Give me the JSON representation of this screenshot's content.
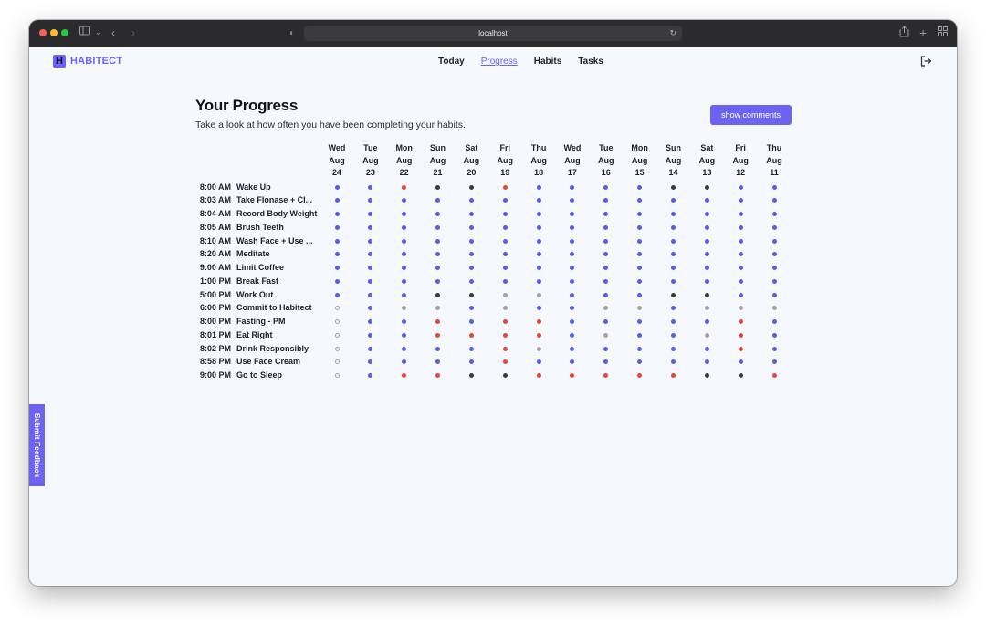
{
  "browser": {
    "url": "localhost"
  },
  "header": {
    "brand": "HABITECT",
    "brand_logo": "H",
    "nav": [
      {
        "label": "Today",
        "active": false
      },
      {
        "label": "Progress",
        "active": true
      },
      {
        "label": "Habits",
        "active": false
      },
      {
        "label": "Tasks",
        "active": false
      }
    ],
    "logout_icon": "logout-icon"
  },
  "main": {
    "title": "Your Progress",
    "subtitle": "Take a look at how often you have been completing your habits.",
    "show_comments_label": "show comments"
  },
  "status_colors": {
    "B": "#5b5be8",
    "R": "#e8443a",
    "K": "#3a3a3e",
    "G": "#a3a3a8",
    "O": "outline-gray"
  },
  "dates": [
    {
      "day": "Wed",
      "month": "Aug",
      "date": "24"
    },
    {
      "day": "Tue",
      "month": "Aug",
      "date": "23"
    },
    {
      "day": "Mon",
      "month": "Aug",
      "date": "22"
    },
    {
      "day": "Sun",
      "month": "Aug",
      "date": "21"
    },
    {
      "day": "Sat",
      "month": "Aug",
      "date": "20"
    },
    {
      "day": "Fri",
      "month": "Aug",
      "date": "19"
    },
    {
      "day": "Thu",
      "month": "Aug",
      "date": "18"
    },
    {
      "day": "Wed",
      "month": "Aug",
      "date": "17"
    },
    {
      "day": "Tue",
      "month": "Aug",
      "date": "16"
    },
    {
      "day": "Mon",
      "month": "Aug",
      "date": "15"
    },
    {
      "day": "Sun",
      "month": "Aug",
      "date": "14"
    },
    {
      "day": "Sat",
      "month": "Aug",
      "date": "13"
    },
    {
      "day": "Fri",
      "month": "Aug",
      "date": "12"
    },
    {
      "day": "Thu",
      "month": "Aug",
      "date": "11"
    }
  ],
  "habits": [
    {
      "time": "8:00 AM",
      "name": "Wake Up",
      "statuses": [
        "B",
        "B",
        "R",
        "K",
        "K",
        "R",
        "B",
        "B",
        "B",
        "B",
        "K",
        "K",
        "B",
        "B"
      ]
    },
    {
      "time": "8:03 AM",
      "name": "Take Flonase + Cl...",
      "statuses": [
        "B",
        "B",
        "B",
        "B",
        "B",
        "B",
        "B",
        "B",
        "B",
        "B",
        "B",
        "B",
        "B",
        "B"
      ]
    },
    {
      "time": "8:04 AM",
      "name": "Record Body Weight",
      "statuses": [
        "B",
        "B",
        "B",
        "B",
        "B",
        "B",
        "B",
        "B",
        "B",
        "B",
        "B",
        "B",
        "B",
        "B"
      ]
    },
    {
      "time": "8:05 AM",
      "name": "Brush Teeth",
      "statuses": [
        "B",
        "B",
        "B",
        "B",
        "B",
        "B",
        "B",
        "B",
        "B",
        "B",
        "B",
        "B",
        "B",
        "B"
      ]
    },
    {
      "time": "8:10 AM",
      "name": "Wash Face + Use ...",
      "statuses": [
        "B",
        "B",
        "B",
        "B",
        "B",
        "B",
        "B",
        "B",
        "B",
        "B",
        "B",
        "B",
        "B",
        "B"
      ]
    },
    {
      "time": "8:20 AM",
      "name": "Meditate",
      "statuses": [
        "B",
        "B",
        "B",
        "B",
        "B",
        "B",
        "B",
        "B",
        "B",
        "B",
        "B",
        "B",
        "B",
        "B"
      ]
    },
    {
      "time": "9:00 AM",
      "name": "Limit Coffee",
      "statuses": [
        "B",
        "B",
        "B",
        "B",
        "B",
        "B",
        "B",
        "B",
        "B",
        "B",
        "B",
        "B",
        "B",
        "B"
      ]
    },
    {
      "time": "1:00 PM",
      "name": "Break Fast",
      "statuses": [
        "B",
        "B",
        "B",
        "B",
        "B",
        "B",
        "B",
        "B",
        "B",
        "B",
        "B",
        "B",
        "B",
        "B"
      ]
    },
    {
      "time": "5:00 PM",
      "name": "Work Out",
      "statuses": [
        "B",
        "B",
        "B",
        "K",
        "K",
        "G",
        "G",
        "B",
        "B",
        "B",
        "K",
        "K",
        "B",
        "B"
      ]
    },
    {
      "time": "6:00 PM",
      "name": "Commit to Habitect",
      "statuses": [
        "O",
        "B",
        "G",
        "G",
        "B",
        "G",
        "B",
        "B",
        "G",
        "G",
        "B",
        "G",
        "G",
        "G"
      ]
    },
    {
      "time": "8:00 PM",
      "name": "Fasting - PM",
      "statuses": [
        "O",
        "B",
        "B",
        "R",
        "B",
        "R",
        "R",
        "B",
        "B",
        "B",
        "B",
        "B",
        "R",
        "B"
      ]
    },
    {
      "time": "8:01 PM",
      "name": "Eat Right",
      "statuses": [
        "O",
        "B",
        "B",
        "R",
        "R",
        "R",
        "R",
        "B",
        "G",
        "B",
        "B",
        "G",
        "R",
        "B"
      ]
    },
    {
      "time": "8:02 PM",
      "name": "Drink Responsibly",
      "statuses": [
        "O",
        "B",
        "B",
        "B",
        "B",
        "R",
        "G",
        "B",
        "B",
        "B",
        "B",
        "B",
        "R",
        "B"
      ]
    },
    {
      "time": "8:58 PM",
      "name": "Use Face Cream",
      "statuses": [
        "O",
        "B",
        "B",
        "B",
        "B",
        "R",
        "B",
        "B",
        "B",
        "B",
        "B",
        "B",
        "B",
        "B"
      ]
    },
    {
      "time": "9:00 PM",
      "name": "Go to Sleep",
      "statuses": [
        "O",
        "B",
        "R",
        "R",
        "K",
        "K",
        "R",
        "R",
        "R",
        "R",
        "R",
        "K",
        "K",
        "R"
      ]
    }
  ],
  "feedback": {
    "label": "Submit Feedback"
  }
}
